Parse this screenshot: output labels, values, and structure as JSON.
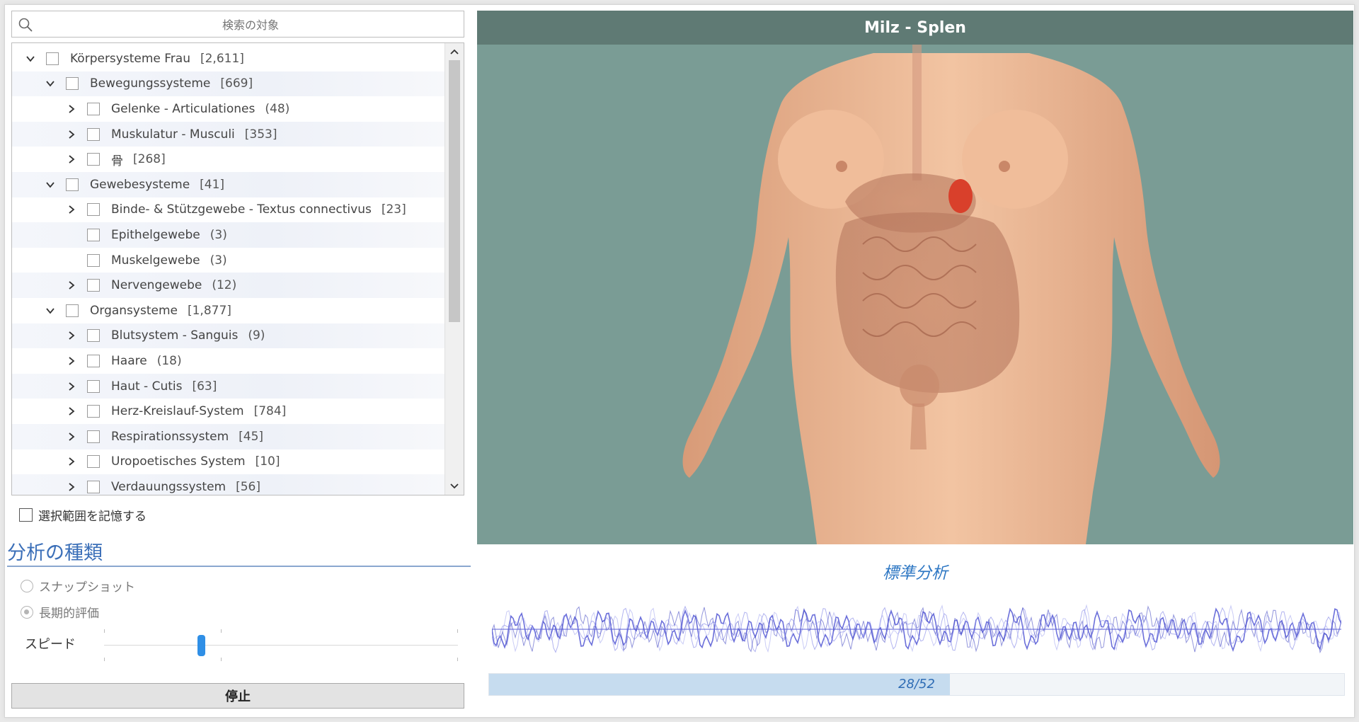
{
  "search": {
    "placeholder": "検索の対象"
  },
  "tree": {
    "rows": [
      {
        "label": "Körpersysteme Frau",
        "count": "[2,611]",
        "level": 0,
        "expander": "open"
      },
      {
        "label": "Bewegungssysteme",
        "count": "[669]",
        "level": 1,
        "expander": "open"
      },
      {
        "label": "Gelenke - Articulationes",
        "count": "(48)",
        "level": 2,
        "expander": "closed"
      },
      {
        "label": "Muskulatur - Musculi",
        "count": "[353]",
        "level": 2,
        "expander": "closed"
      },
      {
        "label": "骨",
        "count": "[268]",
        "level": 2,
        "expander": "closed"
      },
      {
        "label": "Gewebesysteme",
        "count": "[41]",
        "level": 1,
        "expander": "open"
      },
      {
        "label": "Binde- & Stützgewebe - Textus connectivus",
        "count": "[23]",
        "level": 2,
        "expander": "closed"
      },
      {
        "label": "Epithelgewebe",
        "count": "(3)",
        "level": 2,
        "expander": "none"
      },
      {
        "label": "Muskelgewebe",
        "count": "(3)",
        "level": 2,
        "expander": "none"
      },
      {
        "label": "Nervengewebe",
        "count": "(12)",
        "level": 2,
        "expander": "closed"
      },
      {
        "label": "Organsysteme",
        "count": "[1,877]",
        "level": 1,
        "expander": "open"
      },
      {
        "label": "Blutsystem - Sanguis",
        "count": "(9)",
        "level": 2,
        "expander": "closed"
      },
      {
        "label": "Haare",
        "count": "(18)",
        "level": 2,
        "expander": "closed"
      },
      {
        "label": "Haut - Cutis",
        "count": "[63]",
        "level": 2,
        "expander": "closed"
      },
      {
        "label": "Herz-Kreislauf-System",
        "count": "[784]",
        "level": 2,
        "expander": "closed"
      },
      {
        "label": "Respirationssystem",
        "count": "[45]",
        "level": 2,
        "expander": "closed"
      },
      {
        "label": "Uropoetisches System",
        "count": "[10]",
        "level": 2,
        "expander": "closed"
      },
      {
        "label": "Verdauungssystem",
        "count": "[56]",
        "level": 2,
        "expander": "closed"
      }
    ]
  },
  "remember_selection": {
    "label": "選択範囲を記憶する",
    "checked": false
  },
  "analysis_type": {
    "title": "分析の種類",
    "options": [
      {
        "label": "スナップショット",
        "selected": false
      },
      {
        "label": "長期的評価",
        "selected": true
      }
    ]
  },
  "speed": {
    "label": "スピード",
    "value_fraction": 0.27
  },
  "stop_button": {
    "label": "停止"
  },
  "viewer": {
    "title": "Milz - Splen",
    "background": "#7a9c95",
    "highlight_color": "#d9402b"
  },
  "analysis": {
    "title": "標準分析",
    "progress_text": "28/52",
    "progress_current": 28,
    "progress_total": 52
  },
  "icons": {
    "search": "search-icon",
    "expand": "chevron-right-icon",
    "collapse": "chevron-down-icon"
  },
  "colors": {
    "accent": "#3b6fb8",
    "slider": "#2f8fe6",
    "wave": "#5b5fd6",
    "progress_fill": "#c6dcef"
  }
}
